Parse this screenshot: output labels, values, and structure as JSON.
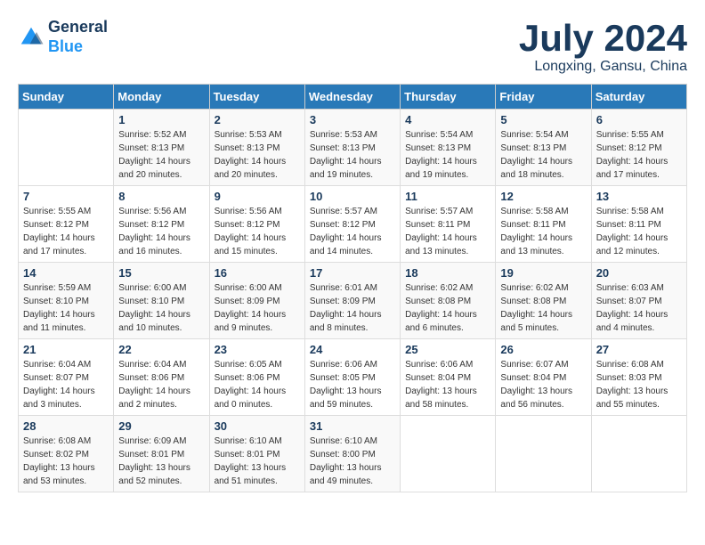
{
  "header": {
    "logo_line1": "General",
    "logo_line2": "Blue",
    "month": "July 2024",
    "location": "Longxing, Gansu, China"
  },
  "days_of_week": [
    "Sunday",
    "Monday",
    "Tuesday",
    "Wednesday",
    "Thursday",
    "Friday",
    "Saturday"
  ],
  "weeks": [
    [
      {
        "day": "",
        "info": ""
      },
      {
        "day": "1",
        "info": "Sunrise: 5:52 AM\nSunset: 8:13 PM\nDaylight: 14 hours\nand 20 minutes."
      },
      {
        "day": "2",
        "info": "Sunrise: 5:53 AM\nSunset: 8:13 PM\nDaylight: 14 hours\nand 20 minutes."
      },
      {
        "day": "3",
        "info": "Sunrise: 5:53 AM\nSunset: 8:13 PM\nDaylight: 14 hours\nand 19 minutes."
      },
      {
        "day": "4",
        "info": "Sunrise: 5:54 AM\nSunset: 8:13 PM\nDaylight: 14 hours\nand 19 minutes."
      },
      {
        "day": "5",
        "info": "Sunrise: 5:54 AM\nSunset: 8:13 PM\nDaylight: 14 hours\nand 18 minutes."
      },
      {
        "day": "6",
        "info": "Sunrise: 5:55 AM\nSunset: 8:12 PM\nDaylight: 14 hours\nand 17 minutes."
      }
    ],
    [
      {
        "day": "7",
        "info": "Sunrise: 5:55 AM\nSunset: 8:12 PM\nDaylight: 14 hours\nand 17 minutes."
      },
      {
        "day": "8",
        "info": "Sunrise: 5:56 AM\nSunset: 8:12 PM\nDaylight: 14 hours\nand 16 minutes."
      },
      {
        "day": "9",
        "info": "Sunrise: 5:56 AM\nSunset: 8:12 PM\nDaylight: 14 hours\nand 15 minutes."
      },
      {
        "day": "10",
        "info": "Sunrise: 5:57 AM\nSunset: 8:12 PM\nDaylight: 14 hours\nand 14 minutes."
      },
      {
        "day": "11",
        "info": "Sunrise: 5:57 AM\nSunset: 8:11 PM\nDaylight: 14 hours\nand 13 minutes."
      },
      {
        "day": "12",
        "info": "Sunrise: 5:58 AM\nSunset: 8:11 PM\nDaylight: 14 hours\nand 13 minutes."
      },
      {
        "day": "13",
        "info": "Sunrise: 5:58 AM\nSunset: 8:11 PM\nDaylight: 14 hours\nand 12 minutes."
      }
    ],
    [
      {
        "day": "14",
        "info": "Sunrise: 5:59 AM\nSunset: 8:10 PM\nDaylight: 14 hours\nand 11 minutes."
      },
      {
        "day": "15",
        "info": "Sunrise: 6:00 AM\nSunset: 8:10 PM\nDaylight: 14 hours\nand 10 minutes."
      },
      {
        "day": "16",
        "info": "Sunrise: 6:00 AM\nSunset: 8:09 PM\nDaylight: 14 hours\nand 9 minutes."
      },
      {
        "day": "17",
        "info": "Sunrise: 6:01 AM\nSunset: 8:09 PM\nDaylight: 14 hours\nand 8 minutes."
      },
      {
        "day": "18",
        "info": "Sunrise: 6:02 AM\nSunset: 8:08 PM\nDaylight: 14 hours\nand 6 minutes."
      },
      {
        "day": "19",
        "info": "Sunrise: 6:02 AM\nSunset: 8:08 PM\nDaylight: 14 hours\nand 5 minutes."
      },
      {
        "day": "20",
        "info": "Sunrise: 6:03 AM\nSunset: 8:07 PM\nDaylight: 14 hours\nand 4 minutes."
      }
    ],
    [
      {
        "day": "21",
        "info": "Sunrise: 6:04 AM\nSunset: 8:07 PM\nDaylight: 14 hours\nand 3 minutes."
      },
      {
        "day": "22",
        "info": "Sunrise: 6:04 AM\nSunset: 8:06 PM\nDaylight: 14 hours\nand 2 minutes."
      },
      {
        "day": "23",
        "info": "Sunrise: 6:05 AM\nSunset: 8:06 PM\nDaylight: 14 hours\nand 0 minutes."
      },
      {
        "day": "24",
        "info": "Sunrise: 6:06 AM\nSunset: 8:05 PM\nDaylight: 13 hours\nand 59 minutes."
      },
      {
        "day": "25",
        "info": "Sunrise: 6:06 AM\nSunset: 8:04 PM\nDaylight: 13 hours\nand 58 minutes."
      },
      {
        "day": "26",
        "info": "Sunrise: 6:07 AM\nSunset: 8:04 PM\nDaylight: 13 hours\nand 56 minutes."
      },
      {
        "day": "27",
        "info": "Sunrise: 6:08 AM\nSunset: 8:03 PM\nDaylight: 13 hours\nand 55 minutes."
      }
    ],
    [
      {
        "day": "28",
        "info": "Sunrise: 6:08 AM\nSunset: 8:02 PM\nDaylight: 13 hours\nand 53 minutes."
      },
      {
        "day": "29",
        "info": "Sunrise: 6:09 AM\nSunset: 8:01 PM\nDaylight: 13 hours\nand 52 minutes."
      },
      {
        "day": "30",
        "info": "Sunrise: 6:10 AM\nSunset: 8:01 PM\nDaylight: 13 hours\nand 51 minutes."
      },
      {
        "day": "31",
        "info": "Sunrise: 6:10 AM\nSunset: 8:00 PM\nDaylight: 13 hours\nand 49 minutes."
      },
      {
        "day": "",
        "info": ""
      },
      {
        "day": "",
        "info": ""
      },
      {
        "day": "",
        "info": ""
      }
    ]
  ]
}
